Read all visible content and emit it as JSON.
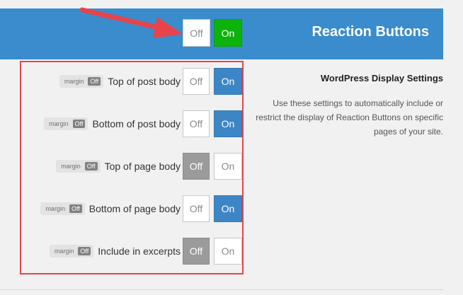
{
  "header": {
    "title": "Reaction Buttons",
    "toggle": {
      "off_label": "Off",
      "on_label": "On",
      "state": "on"
    }
  },
  "badge": {
    "label": "margin",
    "off": "Off"
  },
  "rows": [
    {
      "label": "Top of post body",
      "off": "Off",
      "on": "On",
      "state": "on"
    },
    {
      "label": "Bottom of post body",
      "off": "Off",
      "on": "On",
      "state": "on"
    },
    {
      "label": "Top of page body",
      "off": "Off",
      "on": "On",
      "state": "off"
    },
    {
      "label": "Bottom of page body",
      "off": "Off",
      "on": "On",
      "state": "on"
    },
    {
      "label": "Include in excerpts",
      "off": "Off",
      "on": "On",
      "state": "off"
    }
  ],
  "section": {
    "title": "WordPress Display Settings",
    "description": "Use these settings to automatically include or restrict the display of Reaction Buttons on specific pages of your site."
  },
  "colors": {
    "header_bg": "#3a8ccc",
    "on_green": "#0bb30b",
    "on_blue": "#3d86c6",
    "off_gray": "#9b9b9b",
    "highlight_red": "#e8434a"
  }
}
